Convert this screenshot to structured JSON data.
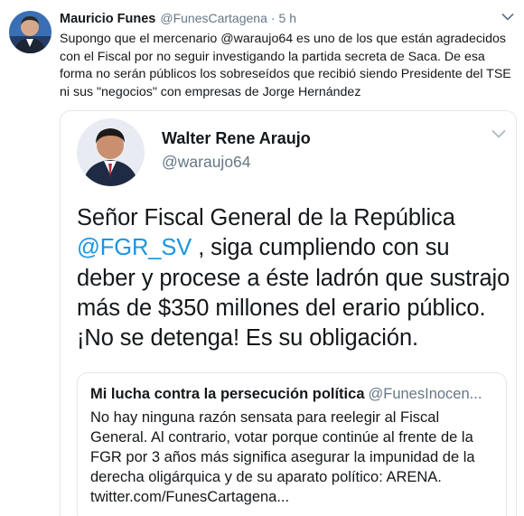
{
  "tweet": {
    "author_name": "Mauricio Funes",
    "author_handle": "@FunesCartagena",
    "separator": "·",
    "time": "5 h",
    "text": "Supongo que el mercenario @waraujo64 es uno de los que están agradecidos con el Fiscal por no seguir investigando la partida secreta de Saca. De esa forma no serán públicos los sobreseídos que recibió siendo Presidente del TSE ni sus \"negocios\" con empresas de Jorge Hernández"
  },
  "quoted_tweet": {
    "author_name": "Walter Rene Araujo",
    "author_handle": "@waraujo64",
    "text_before_mention": "Señor Fiscal General de la República ",
    "mention": "@FGR_SV",
    "text_after_mention": " , siga cumpliendo con su deber y procese a éste ladrón que sustrajo más de $350 millones del erario público. ¡No se detenga! Es su obligación."
  },
  "nested_quote": {
    "author_name": "Mi lucha contra la persecución política",
    "author_handle": "@FunesInocen...",
    "text": "No hay ninguna razón sensata para reelegir al Fiscal General. Al contrario, votar porque continúe al frente de la FGR por 3 años más significa asegurar la impunidad de la derecha oligárquica y de su aparato político: ARENA. twitter.com/FunesCartagena..."
  },
  "icons": {
    "caret": "chevron-down-icon",
    "author_avatar": "avatar",
    "quoted_avatar": "avatar"
  },
  "colors": {
    "link": "#1b95e0",
    "secondary_text": "#657786",
    "border": "#e1e8ed",
    "primary_text": "#14171a"
  }
}
